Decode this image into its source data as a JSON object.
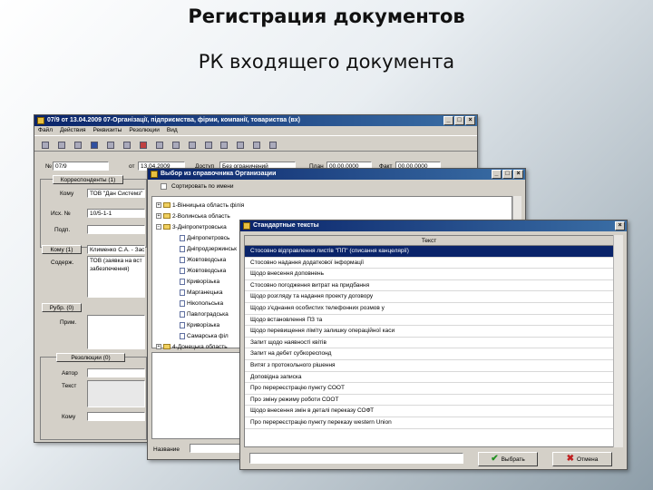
{
  "slide": {
    "title": "Регистрация документов",
    "subtitle": "РК входящего документа"
  },
  "main_window": {
    "title": "07/9 от 13.04.2009 07-Організації, підприємства, фірми, компанії, товариства (вх)",
    "menu": [
      "Файл",
      "Действия",
      "Реквизиты",
      "Резолюции",
      "Вид"
    ],
    "fields": {
      "num_label": "№",
      "num_value": "07/9",
      "from_label": "от",
      "from_value": "13.04.2009",
      "access_label": "Доступ",
      "access_value": "Без ограничений",
      "term_label": "План",
      "term_value": "00.00.0000",
      "fact_label": "Факт",
      "fact_value": "00.00.0000"
    },
    "correspondents_group": "Корреспонденты (1)",
    "corr_label": "Кому",
    "corr_value": "ТОВ \"Дан Системз\"",
    "out_num_label": "Исх. №",
    "out_num_value": "10/5-1-1",
    "sign_label": "Подп.",
    "komu_button": "Кому (1)",
    "komu_value": "Клименко С.А. - Заст.",
    "content_label": "Содерж.",
    "content_value": "ТОВ (заявка на вст забезпечення)",
    "rubric_button": "Рубр. (0)",
    "note_label": "Прим.",
    "resolution_group": "Резолюции (0)",
    "author_label": "Автор",
    "text_label": "Текст",
    "exec_label": "Кому"
  },
  "org_dialog": {
    "title": "Выбор из справочника Организации",
    "sort_label": "Сортировать по имени",
    "tree": [
      {
        "type": "folder",
        "label": "1-Вінницька область філія",
        "expanded": false
      },
      {
        "type": "folder",
        "label": "2-Волинська область",
        "expanded": false
      },
      {
        "type": "folder",
        "label": "3-Дніпропетровська",
        "expanded": true
      },
      {
        "type": "doc",
        "label": "Дніпропетровсь"
      },
      {
        "type": "doc",
        "label": "Дніпродзержинськ"
      },
      {
        "type": "doc",
        "label": "Жовтоводська"
      },
      {
        "type": "doc",
        "label": "Жовтоводська"
      },
      {
        "type": "doc",
        "label": "Криворізька"
      },
      {
        "type": "doc",
        "label": "Марганецька"
      },
      {
        "type": "doc",
        "label": "Нікопольська"
      },
      {
        "type": "doc",
        "label": "Павлоградська"
      },
      {
        "type": "doc",
        "label": "Криворізька"
      },
      {
        "type": "doc",
        "label": "Самарська філ"
      },
      {
        "type": "folder",
        "label": "4-Донецька область",
        "expanded": false
      }
    ],
    "name_label": "Название"
  },
  "texts_dialog": {
    "title": "Стандартные тексты",
    "column_header": "Текст",
    "rows": [
      "Стосовно відправлення листів \"ПП\" (списання канцелярії)",
      "Стосовно надання додаткової інформації",
      "Щодо внесення доповнень",
      "Стосовно погодження витрат на придбання",
      "Щодо розгляду та надання проекту договору",
      "Щодо з'єднання особистих телефонних розмов у",
      "Щодо встановлення ПЗ та",
      "Щодо перевищення ліміту залишку операційної каси",
      "Запит щодо наявності квітів",
      "Запит на дебет субкореспонд",
      "Витяг з протокольного рішення",
      "Доповідна записка",
      "Про перереєстрацію пункту СООТ",
      "Про зміну режиму роботи СООТ",
      "Щодо внесення змін в деталі переказу СОФТ",
      "Про перереєстрацію пункту переказу western Union"
    ],
    "selected_index": 0,
    "ok_label": "Выбрать",
    "cancel_label": "Отмена"
  }
}
